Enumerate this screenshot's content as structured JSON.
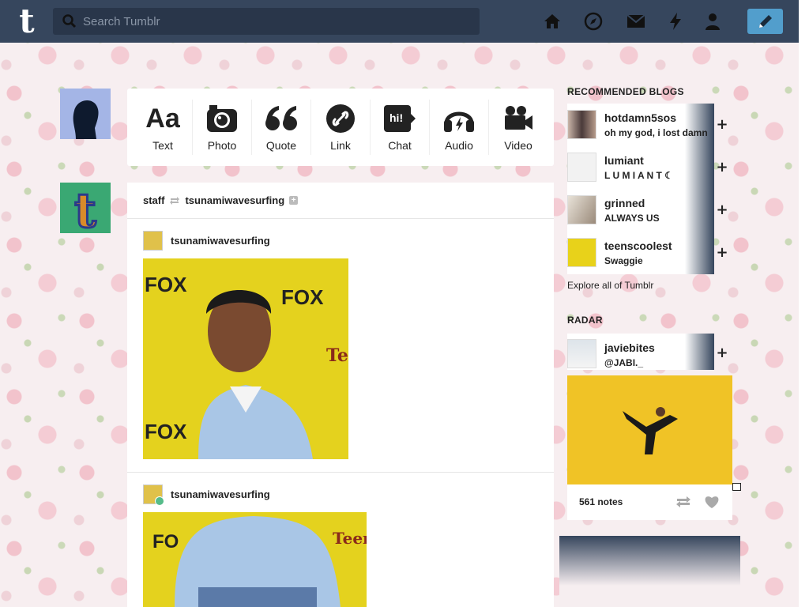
{
  "topbar": {
    "logo": "t",
    "search_placeholder": "Search Tumblr",
    "nav": [
      "home-icon",
      "explore-icon",
      "inbox-icon",
      "activity-icon",
      "account-icon"
    ]
  },
  "post_types": [
    {
      "glyph": "Aa",
      "label": "Text"
    },
    {
      "glyph": "camera",
      "label": "Photo"
    },
    {
      "glyph": "quote",
      "label": "Quote"
    },
    {
      "glyph": "link",
      "label": "Link"
    },
    {
      "glyph": "hi!",
      "label": "Chat"
    },
    {
      "glyph": "headphones",
      "label": "Audio"
    },
    {
      "glyph": "video-camera",
      "label": "Video"
    }
  ],
  "post": {
    "reblogger": "staff",
    "source": "tsunamiwavesurfing",
    "entries": [
      {
        "author": "tsunamiwavesurfing"
      },
      {
        "author": "tsunamiwavesurfing"
      }
    ]
  },
  "recommended": {
    "title": "RECOMMENDED BLOGS",
    "blogs": [
      {
        "name": "hotdamn5sos",
        "sub": "oh my god, i lost damn"
      },
      {
        "name": "lumiant",
        "sub": "L U M I A N T ☾"
      },
      {
        "name": "grinned",
        "sub": "ALWAYS US"
      },
      {
        "name": "teenscoolest",
        "sub": "Swaggie"
      }
    ],
    "explore_link": "Explore all of Tumblr"
  },
  "radar": {
    "title": "RADAR",
    "name": "javiebites",
    "sub": "@JABI._",
    "notes": "561 notes"
  },
  "colors": {
    "nav_bg": "#36465d",
    "compose": "#529ecc",
    "photo_bg": "#e2cf1c",
    "radar_bg": "#f0c326"
  }
}
